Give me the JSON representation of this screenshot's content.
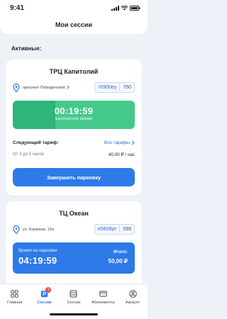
{
  "status_bar": {
    "time": "9:41"
  },
  "header": {
    "title": "Мои сессии"
  },
  "section": {
    "active_label": "Активные:"
  },
  "sessions": [
    {
      "name": "ТРЦ Капитолий",
      "address": "проспект Победителей, 9",
      "plate_number": "т0900еу",
      "plate_region": "750",
      "timer": "00:19:59",
      "timer_caption": "Бесплатное время",
      "next_tariff_label": "Следующий тариф:",
      "all_tariffs_link": "Все тарифы",
      "tariff_period": "От 3 до 5 часов",
      "tariff_price": "40,00 ₽ / час",
      "finish_button": "Завершить парковку"
    },
    {
      "name": "ТЦ Океан",
      "address": "ул. Баумана, 15а",
      "plate_number": "е5608рт",
      "plate_region": "099",
      "timer_label": "Время на парковке",
      "timer": "04:19:59",
      "total_label": "Итого:",
      "total_value": "50,00 ₽"
    }
  ],
  "tabbar": {
    "items": [
      {
        "label": "Главная",
        "icon": "grid-icon"
      },
      {
        "label": "Сессии",
        "icon": "parking-icon",
        "badge": "2",
        "active": true
      },
      {
        "label": "Сессии",
        "icon": "car-icon"
      },
      {
        "label": "Абонементы",
        "icon": "card-icon"
      },
      {
        "label": "Аккаунт",
        "icon": "user-icon"
      }
    ]
  },
  "colors": {
    "accent": "#2d7ae8",
    "success": "#2fb47a",
    "badge": "#e84b5f"
  }
}
